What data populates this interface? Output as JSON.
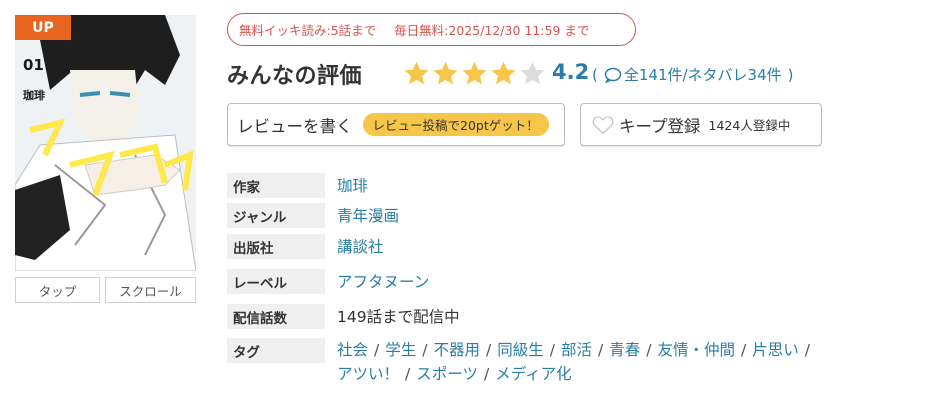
{
  "cover": {
    "badge": "UP",
    "volume": "01",
    "author_on_cover": "珈琲",
    "title_on_cover": "ワンダンス"
  },
  "view_modes": {
    "tap": "タップ",
    "scroll": "スクロール"
  },
  "free_info": {
    "ikki": "無料イッキ読み:5話まで",
    "daily": "毎日無料:2025/12/30 11:59 まで"
  },
  "rating": {
    "title": "みんなの評価",
    "score": "4.2",
    "stars_filled": 4,
    "stars_total": 5,
    "open_paren": "(",
    "total": "全141件",
    "spoiler": "/ネタバレ34件",
    "close_paren": ")",
    "star_color": "#f5c64a",
    "star_empty_color": "#dcdcdc"
  },
  "actions": {
    "review_label": "レビューを書く",
    "review_badge": "レビュー投稿で20ptゲット！",
    "keep_label": "キープ登録",
    "keep_count": "1424人登録中"
  },
  "info": {
    "author": {
      "label": "作家",
      "value": "珈琲"
    },
    "genre": {
      "label": "ジャンル",
      "value": "青年漫画"
    },
    "publisher": {
      "label": "出版社",
      "value": "講談社"
    },
    "label": {
      "label": "レーベル",
      "value": "アフタヌーン"
    },
    "episodes": {
      "label": "配信話数",
      "value": "149話まで配信中"
    },
    "tags": {
      "label": "タグ",
      "items": [
        "社会",
        "学生",
        "不器用",
        "同級生",
        "部活",
        "青春",
        "友情・仲間",
        "片思い",
        "アツい！",
        "スポーツ",
        "メディア化"
      ],
      "separator": "/"
    }
  },
  "colors": {
    "accent_orange": "#e8651f",
    "link_blue": "#2a7ea6",
    "free_red": "#d9534f",
    "badge_yellow": "#f5c64a"
  }
}
